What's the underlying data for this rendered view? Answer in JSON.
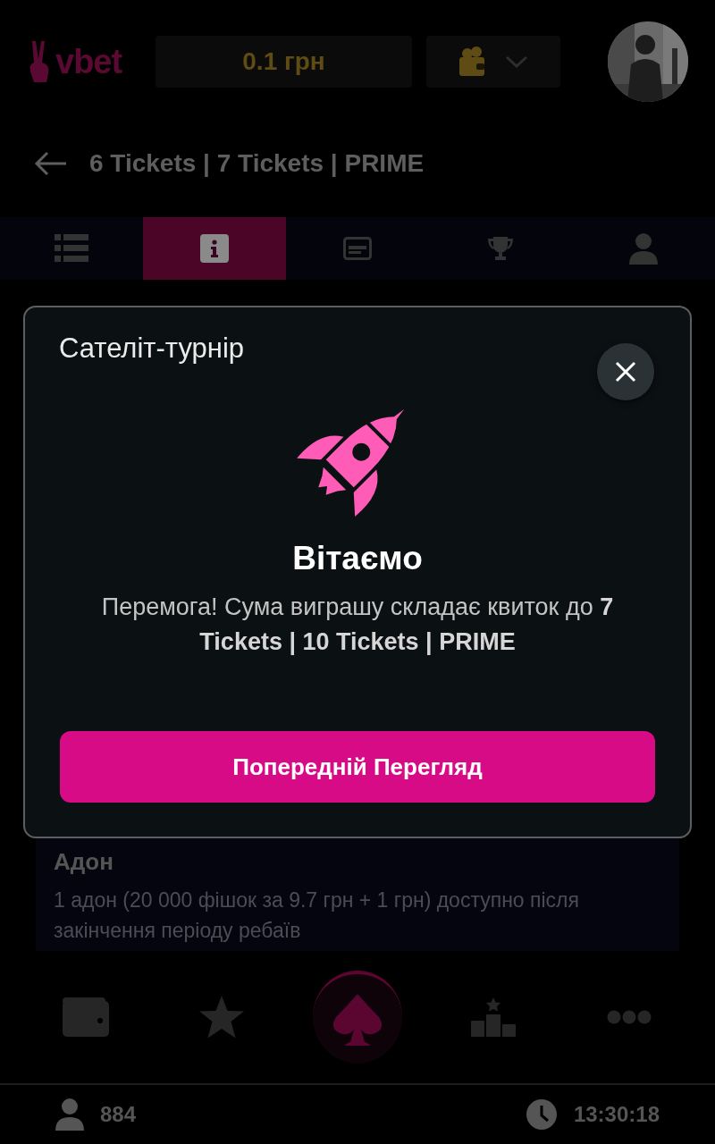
{
  "header": {
    "logo": "vbet",
    "balance": "0.1 грн"
  },
  "title": "6 Tickets | 7 Tickets | PRIME",
  "tabs": [
    {
      "kind": "list",
      "selected": false
    },
    {
      "kind": "info",
      "selected": true
    },
    {
      "kind": "ticket",
      "selected": false
    },
    {
      "kind": "trophy",
      "selected": false
    },
    {
      "kind": "user",
      "selected": false
    }
  ],
  "modal": {
    "title": "Сателіт-турнір",
    "heading": "Вітаємо",
    "message": "Перемога! Сума виграшу складає квиток до **7 Tickets | 10 Tickets | PRIME**",
    "button": "Попередній Перегляд"
  },
  "addon": {
    "title": "Адон",
    "text": "1 адон (20 000 фішок за 9.7 грн + 1 грн) доступно після закінчення періоду ребаїв"
  },
  "bottom_nav": [
    {
      "kind": "wallet",
      "selected": false
    },
    {
      "kind": "star",
      "selected": false
    },
    {
      "kind": "spade",
      "selected": true
    },
    {
      "kind": "podium",
      "selected": false
    },
    {
      "kind": "more",
      "selected": false
    }
  ],
  "status_bar": {
    "players": "884",
    "time": "13:30:18"
  }
}
